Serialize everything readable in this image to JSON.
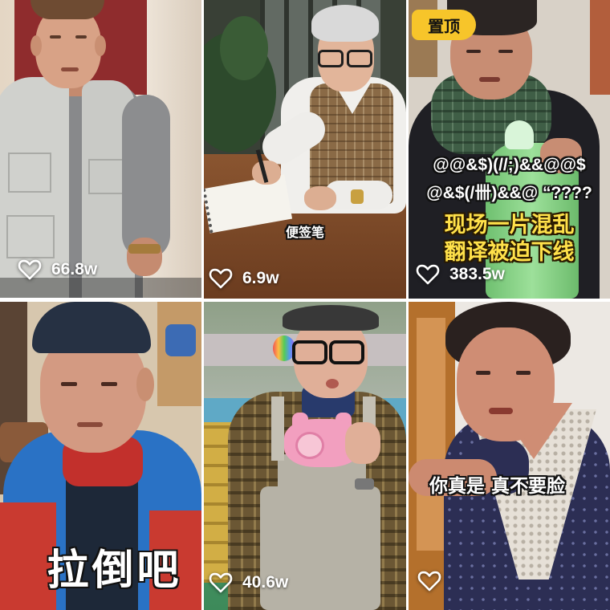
{
  "video_grid": {
    "items": [
      {
        "likes": "66.8w"
      },
      {
        "caption": "便签笔",
        "likes": "6.9w"
      },
      {
        "badge": "置顶",
        "overlay_text": [
          "@@&$)(//;)&&@@$",
          "@&$(/卌)&&@ “????"
        ],
        "caption": [
          "现场一片混乱",
          "翻译被迫下线"
        ],
        "likes": "383.5w"
      },
      {
        "caption": "拉倒吧"
      },
      {
        "likes": "40.6w"
      },
      {
        "caption": "你真是 真不要脸"
      }
    ]
  },
  "icons": {
    "like": "heart-outline-icon"
  },
  "colors": {
    "caption_yellow": "#ffe14a",
    "badge_yellow": "#f7c52a",
    "like_text": "#ffffff"
  }
}
